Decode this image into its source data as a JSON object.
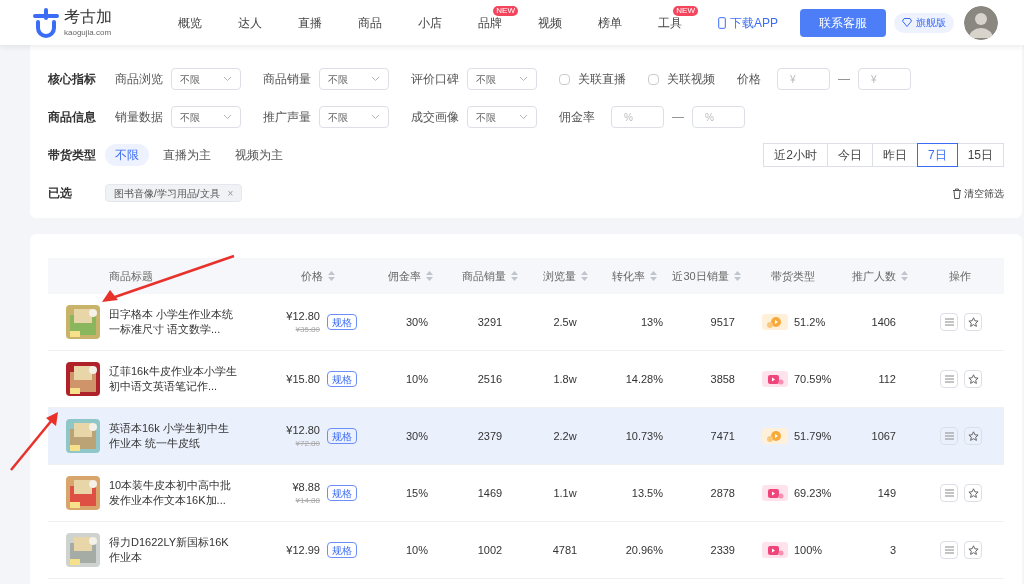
{
  "header": {
    "logo_text": "考古加",
    "logo_sub": "kaogujia.com",
    "nav": [
      {
        "label": "概览"
      },
      {
        "label": "达人"
      },
      {
        "label": "直播"
      },
      {
        "label": "商品"
      },
      {
        "label": "小店"
      },
      {
        "label": "品牌",
        "badge": "NEW"
      },
      {
        "label": "视频"
      },
      {
        "label": "榜单"
      },
      {
        "label": "工具",
        "badge": "NEW"
      }
    ],
    "download": "下载APP",
    "contact": "联系客服",
    "plan": "旗舰版"
  },
  "filters": {
    "rows": [
      {
        "label": "核心指标",
        "items": [
          {
            "kind": "select",
            "label": "商品浏览",
            "value": "不限"
          },
          {
            "kind": "select",
            "label": "商品销量",
            "value": "不限"
          },
          {
            "kind": "select",
            "label": "评价口碑",
            "value": "不限"
          },
          {
            "kind": "checkbox",
            "label": "关联直播",
            "checked": false
          },
          {
            "kind": "checkbox",
            "label": "关联视频",
            "checked": false
          },
          {
            "kind": "range",
            "label": "价格",
            "placeholder": "¥",
            "placeholder2": "¥",
            "sep": "—"
          }
        ]
      },
      {
        "label": "商品信息",
        "items": [
          {
            "kind": "select",
            "label": "销量数据",
            "value": "不限"
          },
          {
            "kind": "select",
            "label": "推广声量",
            "value": "不限"
          },
          {
            "kind": "select",
            "label": "成交画像",
            "value": "不限"
          },
          {
            "kind": "range",
            "label": "佣金率",
            "placeholder": "%",
            "placeholder2": "%",
            "sep": "—"
          }
        ]
      }
    ],
    "type_label": "带货类型",
    "types": [
      {
        "label": "不限",
        "selected": true
      },
      {
        "label": "直播为主",
        "selected": false
      },
      {
        "label": "视频为主",
        "selected": false
      }
    ],
    "periods": [
      {
        "label": "近2小时",
        "selected": false
      },
      {
        "label": "今日",
        "selected": false
      },
      {
        "label": "昨日",
        "selected": false
      },
      {
        "label": "7日",
        "selected": true
      },
      {
        "label": "15日",
        "selected": false
      }
    ],
    "chosen_label": "已选",
    "chosen": [
      {
        "label": "图书音像/学习用品/文具",
        "close": "×"
      }
    ],
    "clear": "清空筛选"
  },
  "table": {
    "columns": [
      {
        "label": "商品标题",
        "sortable": false
      },
      {
        "label": "价格",
        "sortable": true
      },
      {
        "label": "佣金率",
        "sortable": true
      },
      {
        "label": "商品销量",
        "sortable": true
      },
      {
        "label": "浏览量",
        "sortable": true
      },
      {
        "label": "转化率",
        "sortable": true
      },
      {
        "label": "近30日销量",
        "sortable": true
      },
      {
        "label": "带货类型",
        "sortable": false
      },
      {
        "label": "推广人数",
        "sortable": true
      },
      {
        "label": "操作",
        "sortable": false
      }
    ],
    "rows": [
      {
        "title": "田字格本 小学生作业本统一标准尺寸 语文数学...",
        "price": "¥12.80",
        "old_price": "¥35.80",
        "spec": "规格",
        "commission": "30%",
        "sales": "3291",
        "views": "2.5w",
        "conversion": "13%",
        "sales_30d": "9517",
        "kind": "live",
        "share": "51.2%",
        "promoters": "1406",
        "hovered": false
      },
      {
        "title": "辽菲16k牛皮作业本小学生初中语文英语笔记作...",
        "price": "¥15.80",
        "spec": "规格",
        "commission": "10%",
        "sales": "2516",
        "views": "1.8w",
        "conversion": "14.28%",
        "sales_30d": "3858",
        "kind": "video",
        "share": "70.59%",
        "promoters": "112",
        "hovered": false
      },
      {
        "title": "英语本16k 小学生初中生作业本 统一牛皮纸",
        "price": "¥12.80",
        "old_price": "¥72.80",
        "spec": "规格",
        "commission": "30%",
        "sales": "2379",
        "views": "2.2w",
        "conversion": "10.73%",
        "sales_30d": "7471",
        "kind": "live",
        "share": "51.79%",
        "promoters": "1067",
        "hovered": true
      },
      {
        "title": "10本装牛皮本初中高中批发作业本作文本16K加...",
        "price": "¥8.88",
        "old_price": "¥14.88",
        "spec": "规格",
        "commission": "15%",
        "sales": "1469",
        "views": "1.1w",
        "conversion": "13.5%",
        "sales_30d": "2878",
        "kind": "video",
        "share": "69.23%",
        "promoters": "149",
        "hovered": false
      },
      {
        "title": "得力D1622LY新国标16K作业本",
        "price": "¥12.99",
        "spec": "规格",
        "commission": "10%",
        "sales": "1002",
        "views": "4781",
        "conversion": "20.96%",
        "sales_30d": "2339",
        "kind": "video",
        "share": "100%",
        "promoters": "3",
        "hovered": false
      }
    ]
  }
}
